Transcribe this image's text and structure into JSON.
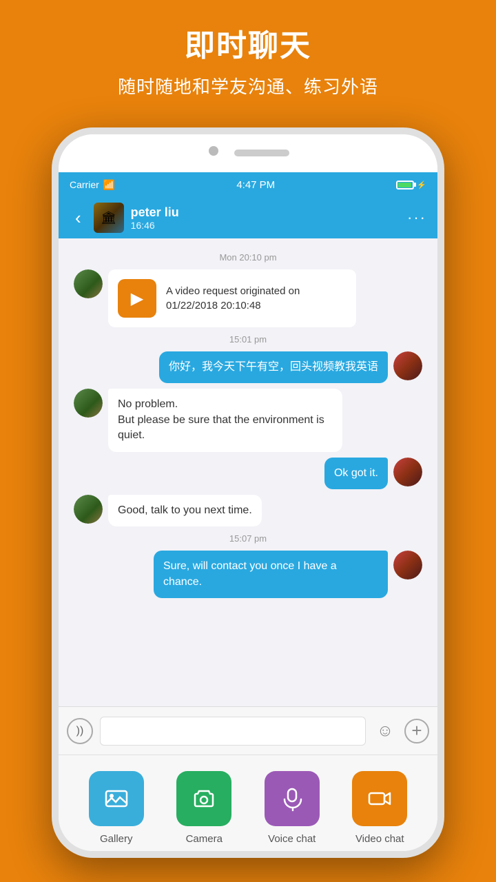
{
  "header": {
    "title": "即时聊天",
    "subtitle": "随时随地和学友沟通、练习外语"
  },
  "status_bar": {
    "carrier": "Carrier",
    "time": "4:47 PM"
  },
  "nav": {
    "back_label": "‹",
    "contact_name": "peter liu",
    "contact_time": "16:46",
    "more_label": "···"
  },
  "chat": {
    "time1": "Mon 20:10 pm",
    "video_request_text": "A video request originated on 01/22/2018 20:10:48",
    "time2": "15:01 pm",
    "msg1": "你好，我今天下午有空，回头视频教我英语",
    "msg2": "No  problem.\nBut  please be sure that the environment is  quiet.",
    "msg3": "Ok got it.",
    "msg4": "Good, talk  to you next time.",
    "time3": "15:07 pm",
    "msg5": "Sure, will contact you once I have a chance."
  },
  "input": {
    "placeholder": ""
  },
  "toolbar": {
    "items": [
      {
        "id": "gallery",
        "label": "Gallery"
      },
      {
        "id": "camera",
        "label": "Camera"
      },
      {
        "id": "voice",
        "label": "Voice chat"
      },
      {
        "id": "video",
        "label": "Video chat"
      }
    ]
  }
}
